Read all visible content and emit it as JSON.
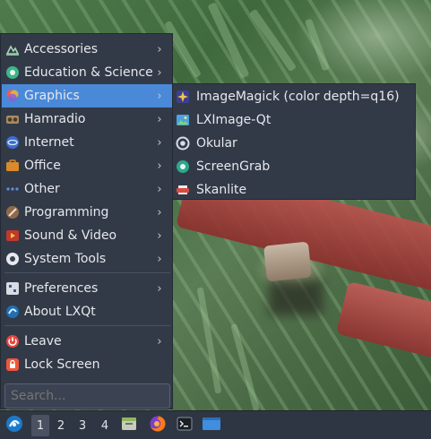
{
  "menu": {
    "items": [
      {
        "label": "Accessories",
        "icon": "accessories-icon",
        "arrow": "›"
      },
      {
        "label": "Education & Science",
        "icon": "education-icon",
        "arrow": "›"
      },
      {
        "label": "Graphics",
        "icon": "graphics-icon",
        "arrow": "›"
      },
      {
        "label": "Hamradio",
        "icon": "hamradio-icon",
        "arrow": "›"
      },
      {
        "label": "Internet",
        "icon": "internet-icon",
        "arrow": "›"
      },
      {
        "label": "Office",
        "icon": "office-icon",
        "arrow": "›"
      },
      {
        "label": "Other",
        "icon": "other-icon",
        "arrow": "›"
      },
      {
        "label": "Programming",
        "icon": "programming-icon",
        "arrow": "›"
      },
      {
        "label": "Sound & Video",
        "icon": "sound-video-icon",
        "arrow": "›"
      },
      {
        "label": "System Tools",
        "icon": "system-tools-icon",
        "arrow": "›"
      }
    ],
    "preferences": {
      "label": "Preferences",
      "arrow": "›"
    },
    "about": {
      "label": "About LXQt"
    },
    "leave": {
      "label": "Leave",
      "arrow": "›"
    },
    "lock": {
      "label": "Lock Screen"
    },
    "search": {
      "placeholder": "Search..."
    }
  },
  "submenu": {
    "items": [
      {
        "label": "ImageMagick (color depth=q16)",
        "icon": "imagemagick-icon"
      },
      {
        "label": "LXImage-Qt",
        "icon": "lximage-icon"
      },
      {
        "label": "Okular",
        "icon": "okular-icon"
      },
      {
        "label": "ScreenGrab",
        "icon": "screengrab-icon"
      },
      {
        "label": "Skanlite",
        "icon": "skanlite-icon"
      }
    ]
  },
  "taskbar": {
    "desktops": [
      "1",
      "2",
      "3",
      "4"
    ],
    "current_desktop": "1"
  },
  "colors": {
    "menu_bg": "#323a48",
    "highlight": "#4a89d8",
    "taskbar_bg": "#2f3643"
  }
}
